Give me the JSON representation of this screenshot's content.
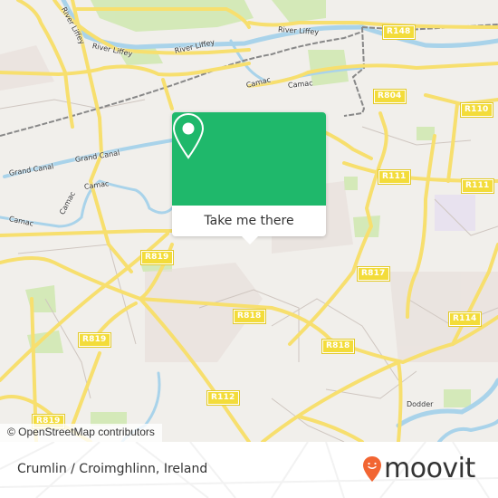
{
  "map": {
    "road_labels": [
      {
        "id": "r148",
        "label": "R148"
      },
      {
        "id": "r804",
        "label": "R804"
      },
      {
        "id": "r110",
        "label": "R110"
      },
      {
        "id": "r111a",
        "label": "R111"
      },
      {
        "id": "r111b",
        "label": "R111"
      },
      {
        "id": "r819a",
        "label": "R819"
      },
      {
        "id": "r819b",
        "label": "R819"
      },
      {
        "id": "r819c",
        "label": "R819"
      },
      {
        "id": "r817",
        "label": "R817"
      },
      {
        "id": "r818a",
        "label": "R818"
      },
      {
        "id": "r818b",
        "label": "R818"
      },
      {
        "id": "r114",
        "label": "R114"
      },
      {
        "id": "r112",
        "label": "R112"
      }
    ],
    "water_labels": [
      {
        "id": "liffey1",
        "label": "River Liffey"
      },
      {
        "id": "liffey2",
        "label": "River Liffey"
      },
      {
        "id": "liffey3",
        "label": "River Liffey"
      },
      {
        "id": "liffey4",
        "label": "River Liffey"
      },
      {
        "id": "camac1",
        "label": "Camac"
      },
      {
        "id": "camac2",
        "label": "Camac"
      },
      {
        "id": "camac3",
        "label": "Camac"
      },
      {
        "id": "camac4",
        "label": "Camac"
      },
      {
        "id": "camac5",
        "label": "Camac"
      },
      {
        "id": "canal1",
        "label": "Grand Canal"
      },
      {
        "id": "canal2",
        "label": "Grand Canal"
      },
      {
        "id": "dodder",
        "label": "Dodder"
      }
    ],
    "attribution": "© OpenStreetMap contributors"
  },
  "popup": {
    "icon": "map-pin-icon",
    "button_label": "Take me there",
    "accent_color": "#1fb86b"
  },
  "footer": {
    "place_name": "Crumlin / Croimghlinn, Ireland",
    "brand": "moovit",
    "brand_color": "#f26532"
  }
}
